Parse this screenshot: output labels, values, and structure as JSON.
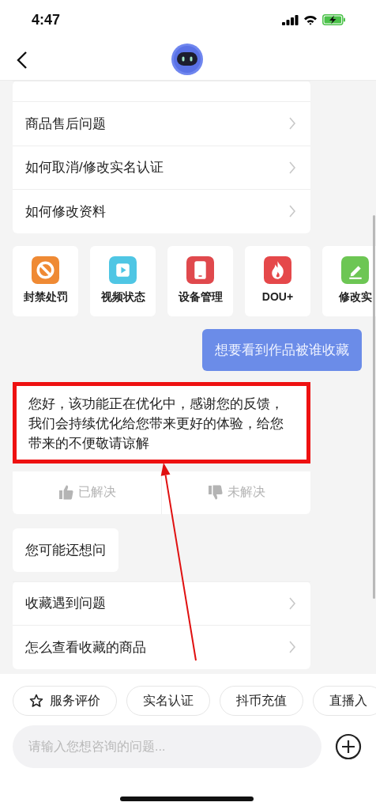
{
  "status_bar": {
    "time": "4:47"
  },
  "topics": [
    {
      "label": "商品售后问题"
    },
    {
      "label": "如何取消/修改实名认证"
    },
    {
      "label": "如何修改资料"
    }
  ],
  "shortcuts": [
    {
      "label": "封禁处罚",
      "kind": "ban",
      "color": "#ef8a34"
    },
    {
      "label": "视频状态",
      "kind": "play",
      "color": "#4fc6e4"
    },
    {
      "label": "设备管理",
      "kind": "phone",
      "color": "#e0494d"
    },
    {
      "label": "DOU+",
      "kind": "fire",
      "color": "#e5484a"
    },
    {
      "label": "修改实",
      "kind": "edit",
      "color": "#6dc654"
    }
  ],
  "user_message": "想要看到作品被谁收藏",
  "answer": {
    "text": "您好，该功能正在优化中，感谢您的反馈，我们会持续优化给您带来更好的体验，给您带来的不便敬请谅解",
    "highlighted": true
  },
  "feedback": [
    {
      "label": "已解决",
      "kind": "up"
    },
    {
      "label": "未解决",
      "kind": "down"
    }
  ],
  "suggest_title": "您可能还想问",
  "suggestions": [
    {
      "label": "收藏遇到问题"
    },
    {
      "label": "怎么查看收藏的商品"
    }
  ],
  "quick_chips": [
    {
      "label": "服务评价",
      "kind": "star"
    },
    {
      "label": "实名认证",
      "kind": "plain"
    },
    {
      "label": "抖币充值",
      "kind": "plain"
    },
    {
      "label": "直播入",
      "kind": "plain"
    }
  ],
  "input": {
    "placeholder": "请输入您想咨询的问题..."
  }
}
